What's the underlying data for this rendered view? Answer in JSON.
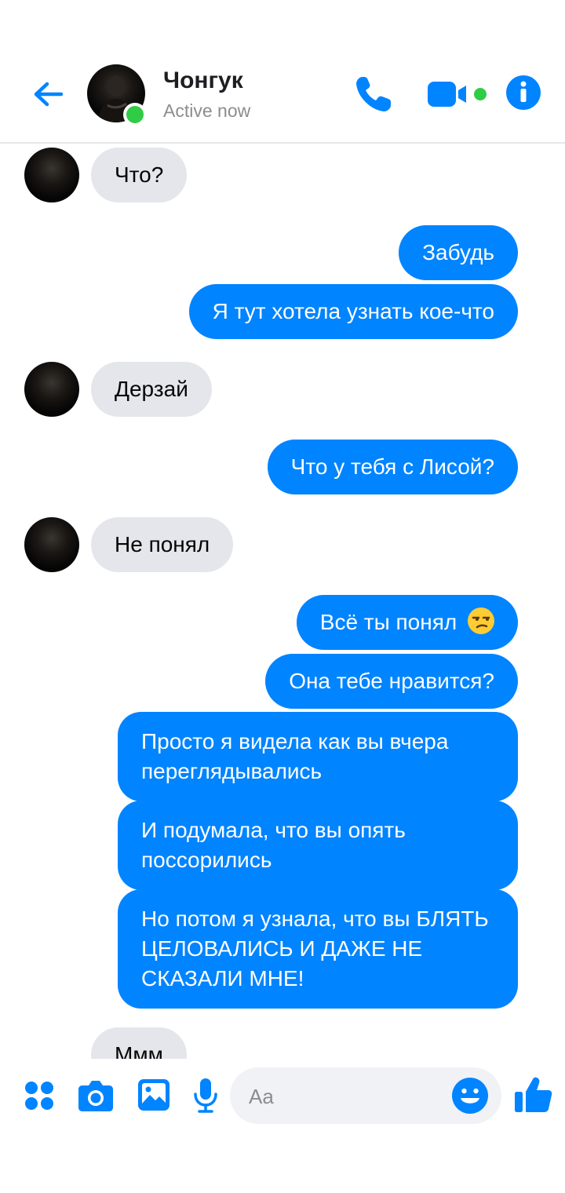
{
  "header": {
    "contact_name": "Чонгук",
    "status": "Active now"
  },
  "colors": {
    "accent": "#0084ff",
    "incoming_bubble": "#e4e6eb",
    "online": "#31cc46"
  },
  "messages": [
    {
      "direction": "incoming",
      "text": "Что?"
    },
    {
      "direction": "outgoing",
      "text": "Забудь"
    },
    {
      "direction": "outgoing",
      "text": "Я тут хотела узнать кое-что"
    },
    {
      "direction": "incoming",
      "text": "Дерзай"
    },
    {
      "direction": "outgoing",
      "text": "Что у тебя с Лисой?"
    },
    {
      "direction": "incoming",
      "text": "Не понял"
    },
    {
      "direction": "outgoing",
      "text": "Всё ты понял",
      "emoji": "unamused-face"
    },
    {
      "direction": "outgoing",
      "text": "Она тебе нравится?"
    },
    {
      "direction": "outgoing",
      "text": "Просто я видела как вы вчера переглядывались"
    },
    {
      "direction": "outgoing",
      "text": "И подумала, что вы опять поссорились"
    },
    {
      "direction": "outgoing",
      "text": "Но потом я узнала, что вы БЛЯТЬ ЦЕЛОВАЛИСЬ И ДАЖЕ НЕ СКАЗАЛИ МНЕ!"
    },
    {
      "direction": "incoming",
      "text": "Ммм"
    }
  ],
  "composer": {
    "placeholder": "Aa",
    "icons": [
      "apps-icon",
      "camera-icon",
      "gallery-icon",
      "microphone-icon",
      "emoji-icon",
      "thumbs-up-icon"
    ]
  }
}
